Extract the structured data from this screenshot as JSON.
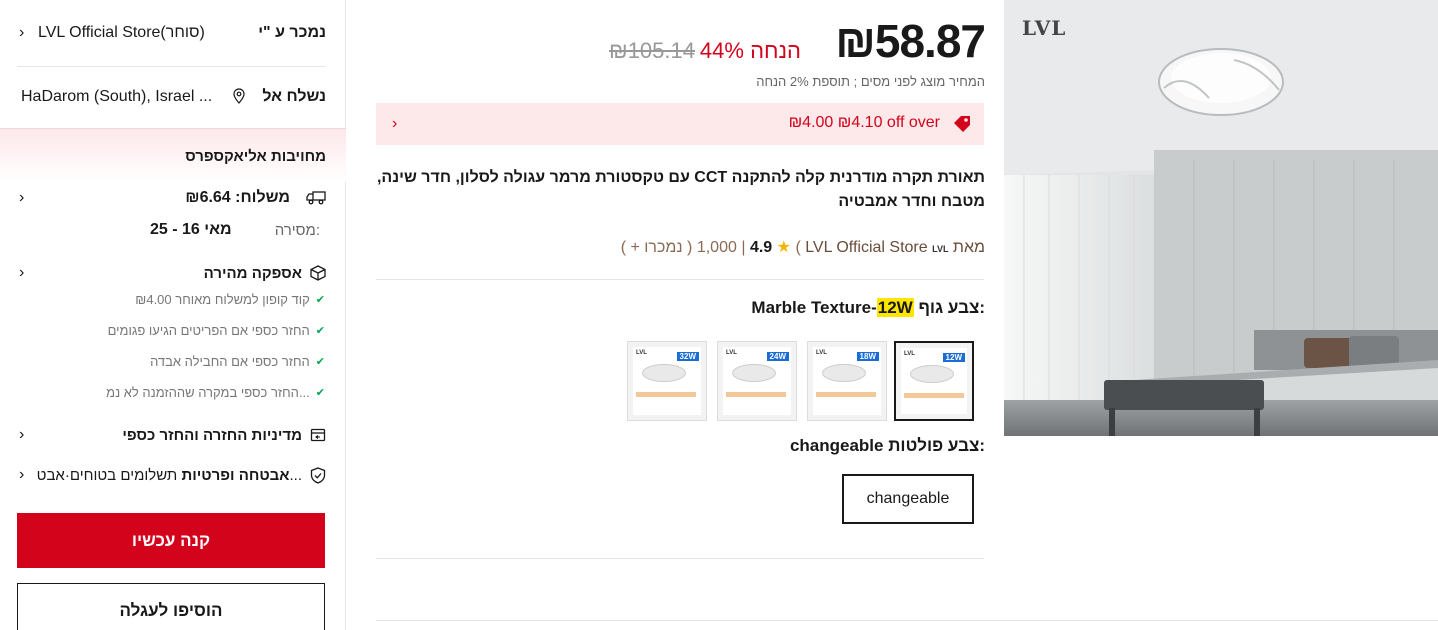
{
  "seller": {
    "label": "נמכר ע \"י",
    "store": "LVL Official Store(סוחר)"
  },
  "ship_to": {
    "label": "נשלח אל",
    "location": "HaDarom (South), Israel ..."
  },
  "commitments": {
    "title": "מחויבות אליאקספרס",
    "shipping": "משלוח: ₪6.64",
    "delivery_label": "מסירה:",
    "delivery_value": "מאי 16 - 25",
    "fast_delivery": "אספקה מהירה",
    "benefits": [
      "₪4.00 קוד קופון למשלוח מאוחר",
      "החזר כספי אם הפריטים הגיעו פגומים",
      "החזר כספי אם החבילה אבדה",
      "החזר כספי במקרה שההזמנה לא נמ..."
    ],
    "returns": "מדיניות החזרה והחזר כספי",
    "security_bold": "אבטחה ופרטיות",
    "security_rest": "תשלומים בטוחים·אבט..."
  },
  "actions": {
    "buy_now": "קנה עכשיו",
    "add_to_cart": "הוסיפו לעגלה"
  },
  "price": {
    "current": "₪58.87",
    "original": "₪105.14",
    "discount": "44% הנחה",
    "tax_note": "המחיר מוצג לפני מסים ; תוספת 2% הנחה"
  },
  "coupon": {
    "text": "₪4.00 ₪4.10 off over"
  },
  "product": {
    "title": "תאורת תקרה מודרנית קלה להתקנה CCT עם טקסטורת מרמר עגולה לסלון, חדר שינה, מטבח וחדר אמבטיה",
    "from_label": "מאת",
    "store_name": "LVL Official Store",
    "sold_count": "1,000",
    "rating": "4.9",
    "sold_label": "+ נמכרו )",
    "logo_text": "LVL"
  },
  "variants": {
    "body_color_label": "צבע גוף:",
    "body_color_value": "Marble Texture-",
    "body_color_highlight": "12W",
    "swatches": [
      "12W",
      "18W",
      "24W",
      "32W"
    ],
    "light_color_label": "צבע פולטות:",
    "light_color_value": "changeable",
    "option_label": "changeable"
  },
  "image": {
    "brand": "LVL"
  },
  "colors": {
    "accent": "#d3031c",
    "coupon_bg": "#fde8ea",
    "highlight": "#ffe600"
  }
}
